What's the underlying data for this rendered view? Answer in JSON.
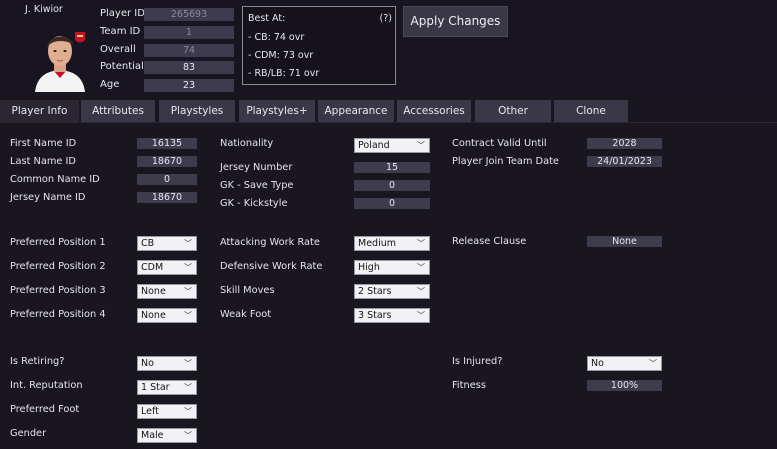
{
  "header": {
    "player_name": "J. Kiwior",
    "fields": [
      {
        "label": "Player ID",
        "value": "265693",
        "muted": true
      },
      {
        "label": "Team ID",
        "value": "1",
        "muted": true
      },
      {
        "label": "Overall",
        "value": "74",
        "muted": true
      },
      {
        "label": "Potential",
        "value": "83",
        "muted": false
      },
      {
        "label": "Age",
        "value": "23",
        "muted": false
      }
    ],
    "best_at": {
      "title": "Best At:",
      "help": "(?)",
      "lines": [
        "- CB: 74 ovr",
        "- CDM: 73 ovr",
        "- RB/LB: 71 ovr"
      ]
    },
    "apply_label": "Apply Changes"
  },
  "tabs": [
    "Player Info",
    "Attributes",
    "Playstyles",
    "Playstyles+",
    "Appearance",
    "Accessories",
    "Other",
    "Clone"
  ],
  "active_tab": "Player Info",
  "names": {
    "first_name_id": {
      "label": "First Name ID",
      "value": "16135"
    },
    "last_name_id": {
      "label": "Last Name ID",
      "value": "18670"
    },
    "common_name_id": {
      "label": "Common Name ID",
      "value": "0"
    },
    "jersey_name_id": {
      "label": "Jersey Name ID",
      "value": "18670"
    }
  },
  "nationality": {
    "label": "Nationality",
    "value": "Poland"
  },
  "jersey_number": {
    "label": "Jersey Number",
    "value": "15"
  },
  "gk_save_type": {
    "label": "GK - Save Type",
    "value": "0"
  },
  "gk_kickstyle": {
    "label": "GK - Kickstyle",
    "value": "0"
  },
  "contract_valid_until": {
    "label": "Contract Valid Until",
    "value": "2028"
  },
  "join_team_date": {
    "label": "Player Join Team Date",
    "value": "24/01/2023"
  },
  "positions": [
    {
      "label": "Preferred Position 1",
      "value": "CB"
    },
    {
      "label": "Preferred Position 2",
      "value": "CDM"
    },
    {
      "label": "Preferred Position 3",
      "value": "None"
    },
    {
      "label": "Preferred Position 4",
      "value": "None"
    }
  ],
  "attacking_work_rate": {
    "label": "Attacking Work Rate",
    "value": "Medium"
  },
  "defensive_work_rate": {
    "label": "Defensive Work Rate",
    "value": "High"
  },
  "skill_moves": {
    "label": "Skill Moves",
    "value": "2 Stars"
  },
  "weak_foot": {
    "label": "Weak Foot",
    "value": "3 Stars"
  },
  "release_clause": {
    "label": "Release Clause",
    "value": "None"
  },
  "is_retiring": {
    "label": "Is Retiring?",
    "value": "No"
  },
  "int_reputation": {
    "label": "Int. Reputation",
    "value": "1 Star"
  },
  "preferred_foot": {
    "label": "Preferred Foot",
    "value": "Left"
  },
  "gender": {
    "label": "Gender",
    "value": "Male"
  },
  "is_injured": {
    "label": "Is Injured?",
    "value": "No"
  },
  "fitness": {
    "label": "Fitness",
    "value": "100%"
  },
  "dropdown_arrow": "chevron-down-icon"
}
